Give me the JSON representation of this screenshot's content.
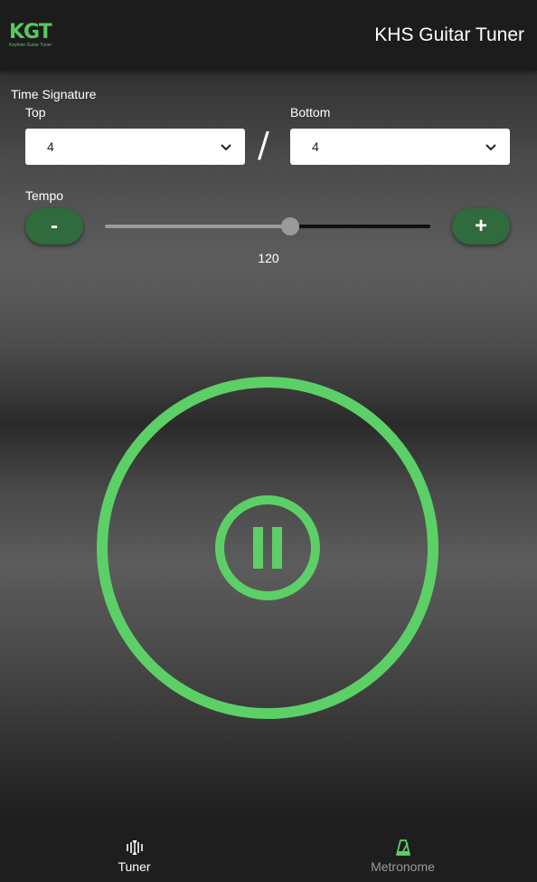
{
  "app_bar": {
    "logo_text": "KGT",
    "logo_subtext": "Keyhole Guitar Tuner",
    "title": "KHS Guitar Tuner"
  },
  "time_signature": {
    "label": "Time Signature",
    "top_label": "Top",
    "top_value": "4",
    "separator": "/",
    "bottom_label": "Bottom",
    "bottom_value": "4"
  },
  "tempo": {
    "label": "Tempo",
    "decrement_label": "-",
    "increment_label": "+",
    "value": "120",
    "slider_fraction": 0.57
  },
  "nav": {
    "items": [
      {
        "label": "Tuner",
        "icon": "waveform-icon",
        "color": "#ffffff"
      },
      {
        "label": "Metronome",
        "icon": "metronome-icon",
        "color": "#9a9a9a"
      }
    ]
  },
  "colors": {
    "accent": "#5cd066",
    "button": "#2f6b3c",
    "app_bar": "#1c1c1c"
  }
}
